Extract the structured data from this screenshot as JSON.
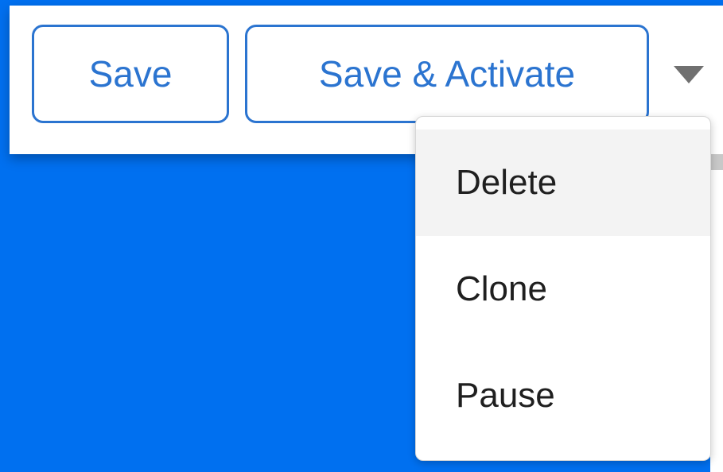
{
  "toolbar": {
    "save_label": "Save",
    "save_activate_label": "Save & Activate",
    "more_icon": "caret-down-icon"
  },
  "menu": {
    "items": [
      {
        "label": "Delete",
        "highlighted": true
      },
      {
        "label": "Clone",
        "highlighted": false
      },
      {
        "label": "Pause",
        "highlighted": false
      }
    ]
  },
  "colors": {
    "page_background": "#0070F0",
    "accent": "#2B74D0",
    "caret": "#707070",
    "menu_text": "#1f1f1f",
    "menu_highlight": "#f3f3f3"
  }
}
